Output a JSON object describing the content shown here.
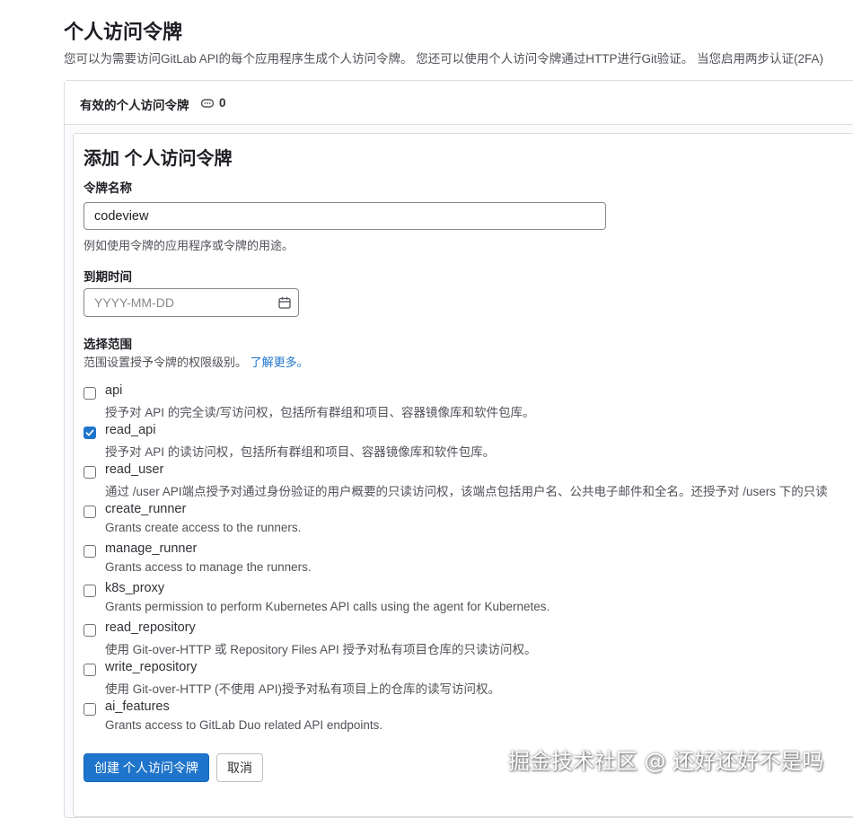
{
  "page": {
    "title": "个人访问令牌",
    "description": "您可以为需要访问GitLab API的每个应用程序生成个人访问令牌。 您还可以使用个人访问令牌通过HTTP进行Git验证。 当您启用两步认证(2FA)"
  },
  "active_tokens": {
    "label": "有效的个人访问令牌",
    "icon": "token-count-icon",
    "count": "0"
  },
  "form": {
    "title": "添加 个人访问令牌",
    "name_label": "令牌名称",
    "name_value": "codeview",
    "name_help": "例如使用令牌的应用程序或令牌的用途。",
    "expiry_label": "到期时间",
    "expiry_placeholder": "YYYY-MM-DD",
    "scopes_label": "选择范围",
    "scopes_help": "范围设置授予令牌的权限级别。",
    "learn_more": "了解更多。",
    "scopes": [
      {
        "name": "api",
        "description": "授予对 API 的完全读/写访问权，包括所有群组和项目、容器镜像库和软件包库。",
        "checked": false
      },
      {
        "name": "read_api",
        "description": "授予对 API 的读访问权，包括所有群组和项目、容器镜像库和软件包库。",
        "checked": true
      },
      {
        "name": "read_user",
        "description": "通过 /user API端点授予对通过身份验证的用户概要的只读访问权，该端点包括用户名、公共电子邮件和全名。还授予对 /users 下的只读",
        "checked": false
      },
      {
        "name": "create_runner",
        "description": "Grants create access to the runners.",
        "checked": false
      },
      {
        "name": "manage_runner",
        "description": "Grants access to manage the runners.",
        "checked": false
      },
      {
        "name": "k8s_proxy",
        "description": "Grants permission to perform Kubernetes API calls using the agent for Kubernetes.",
        "checked": false
      },
      {
        "name": "read_repository",
        "description": "使用 Git-over-HTTP 或 Repository Files API 授予对私有项目仓库的只读访问权。",
        "checked": false
      },
      {
        "name": "write_repository",
        "description": "使用 Git-over-HTTP (不使用 API)授予对私有项目上的仓库的读写访问权。",
        "checked": false
      },
      {
        "name": "ai_features",
        "description": "Grants access to GitLab Duo related API endpoints.",
        "checked": false
      }
    ],
    "create_button": "创建 个人访问令牌",
    "cancel_button": "取消"
  },
  "watermark": "掘金技术社区 @ 还好还好不是吗",
  "colors": {
    "primary": "#1f75cb",
    "border": "#dcdcde",
    "text": "#333238"
  }
}
